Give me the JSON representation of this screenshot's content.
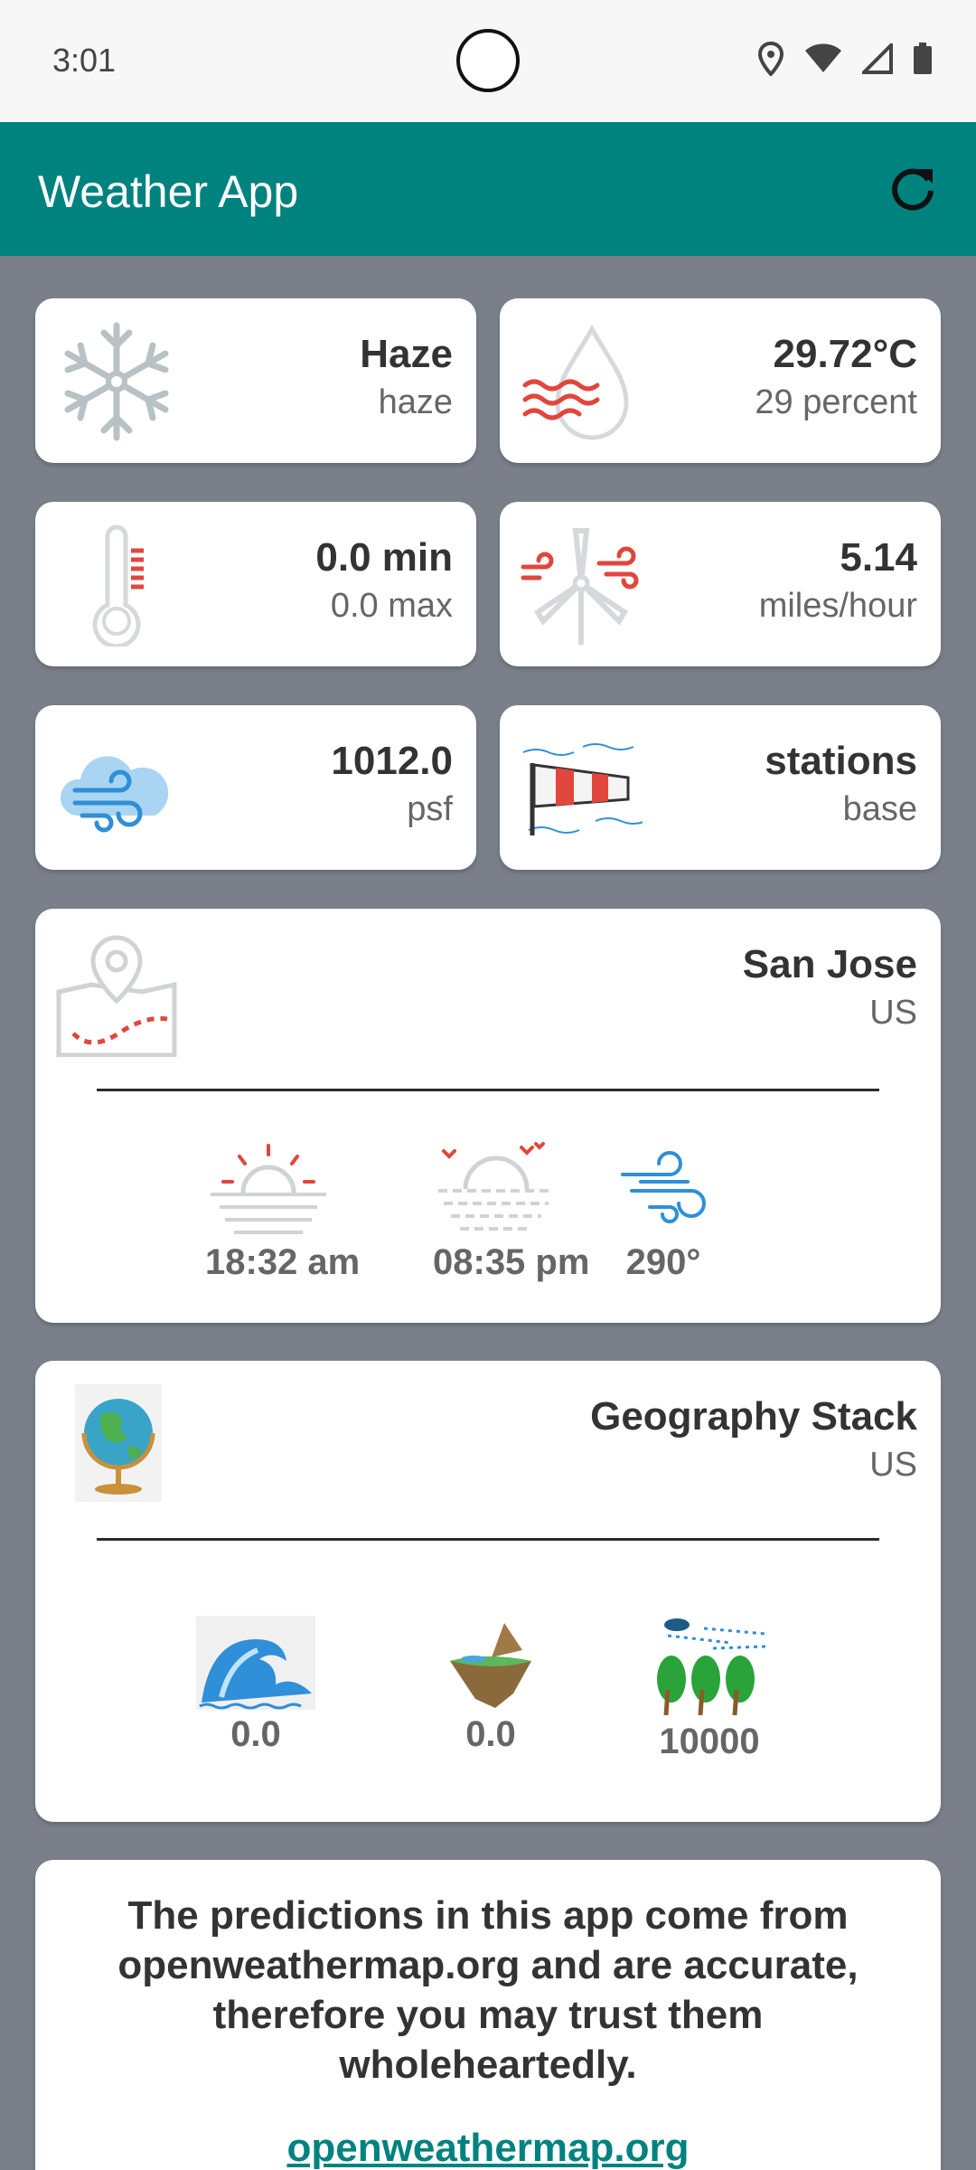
{
  "status_bar": {
    "time": "3:01"
  },
  "app_bar": {
    "title": "Weather App",
    "refresh_icon": "refresh-icon"
  },
  "cards": {
    "condition": {
      "title": "Haze",
      "subtitle": "haze",
      "icon": "snowflake-icon"
    },
    "humidity": {
      "title": "29.72°C",
      "subtitle": "29 percent",
      "icon": "humidity-drop-icon"
    },
    "temperature": {
      "title": "0.0 min",
      "subtitle": "0.0 max",
      "icon": "thermometer-icon"
    },
    "wind": {
      "title": "5.14",
      "subtitle": "miles/hour",
      "icon": "wind-turbine-icon"
    },
    "pressure": {
      "title": "1012.0",
      "subtitle": "psf",
      "icon": "cloud-wind-icon"
    },
    "station": {
      "title": "stations",
      "subtitle": "base",
      "icon": "windsock-icon"
    }
  },
  "location": {
    "city": "San Jose",
    "country": "US",
    "icon": "map-pin-icon",
    "sunrise": "18:32 am",
    "sunset": "08:35 pm",
    "wind_deg": "290°"
  },
  "geography": {
    "title": "Geography Stack",
    "country": "US",
    "icon": "globe-icon",
    "sea_level": "0.0",
    "ground_level": "0.0",
    "visibility": "10000"
  },
  "note": {
    "text": "The predictions in this app come from openweathermap.org and are accurate, therefore you may trust them wholeheartedly.",
    "link": "openweathermap.org"
  },
  "colors": {
    "accent": "#00827f",
    "background": "#7a7f8a",
    "red": "#e0463c",
    "blue": "#2f8fd8"
  }
}
